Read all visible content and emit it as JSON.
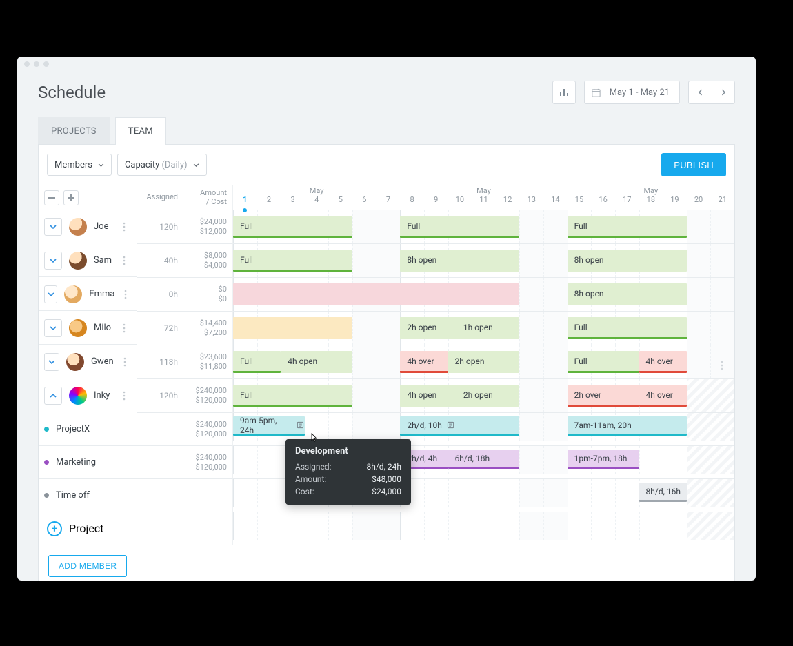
{
  "page_title": "Schedule",
  "range_text": "May 1 - May 21",
  "tabs": {
    "projects": "PROJECTS",
    "team": "TEAM"
  },
  "dropdowns": {
    "members_label": "Members",
    "capacity_label": "Capacity",
    "capacity_mode": "(Daily)"
  },
  "publish_label": "PUBLISH",
  "columns": {
    "assigned": "Assigned",
    "amount_cost": "Amount\n/ Cost"
  },
  "months": [
    "May",
    "May",
    "May"
  ],
  "days": [
    1,
    2,
    3,
    4,
    5,
    6,
    7,
    8,
    9,
    10,
    11,
    12,
    13,
    14,
    15,
    16,
    17,
    18,
    19,
    20,
    21
  ],
  "today_index": 0,
  "members": [
    {
      "name": "Joe",
      "avatar_cls": "av0",
      "assigned": "120h",
      "amount": "$24,000",
      "cost": "$12,000",
      "blocks": [
        {
          "start": 0,
          "span": 5,
          "kind": "full",
          "label": "Full"
        },
        {
          "start": 7,
          "span": 5,
          "kind": "full",
          "label": "Full"
        },
        {
          "start": 14,
          "span": 5,
          "kind": "full",
          "label": "Full"
        }
      ]
    },
    {
      "name": "Sam",
      "avatar_cls": "av1",
      "assigned": "40h",
      "amount": "$8,000",
      "cost": "$4,000",
      "blocks": [
        {
          "start": 0,
          "span": 5,
          "kind": "full",
          "label": "Full"
        },
        {
          "start": 7,
          "span": 5,
          "kind": "open",
          "label": "8h open"
        },
        {
          "start": 14,
          "span": 5,
          "kind": "open",
          "label": "8h open"
        }
      ]
    },
    {
      "name": "Emma",
      "avatar_cls": "av2",
      "assigned": "0h",
      "amount": "$0",
      "cost": "$0",
      "blocks": [
        {
          "start": 0,
          "span": 12,
          "kind": "pink",
          "label": ""
        },
        {
          "start": 14,
          "span": 5,
          "kind": "open",
          "label": "8h open"
        }
      ]
    },
    {
      "name": "Milo",
      "avatar_cls": "av3",
      "assigned": "72h",
      "amount": "$14,400",
      "cost": "$7,200",
      "blocks": [
        {
          "start": 0,
          "span": 5,
          "kind": "yellow",
          "label": ""
        },
        {
          "start": 7,
          "span": 5,
          "kind": "open",
          "labels": [
            "2h open",
            "1h open"
          ]
        },
        {
          "start": 14,
          "span": 5,
          "kind": "full",
          "label": "Full"
        }
      ]
    },
    {
      "name": "Gwen",
      "avatar_cls": "av4",
      "assigned": "118h",
      "amount": "$23,600",
      "cost": "$11,800",
      "blocks": [
        {
          "start": 0,
          "span": 2,
          "kind": "full",
          "label": "Full"
        },
        {
          "start": 2,
          "span": 3,
          "kind": "open",
          "label": "4h open"
        },
        {
          "start": 7,
          "span": 2,
          "kind": "over",
          "label": "4h over"
        },
        {
          "start": 9,
          "span": 3,
          "kind": "open",
          "label": "2h open"
        },
        {
          "start": 14,
          "span": 3,
          "kind": "full",
          "label": "Full"
        },
        {
          "start": 17,
          "span": 2,
          "kind": "over",
          "label": "4h over"
        }
      ]
    },
    {
      "name": "Inky",
      "avatar_cls": "av5",
      "assigned": "120h",
      "amount": "$240,000",
      "cost": "$120,000",
      "expanded": true,
      "blocks": [
        {
          "start": 0,
          "span": 5,
          "kind": "full",
          "label": "Full"
        },
        {
          "start": 7,
          "span": 5,
          "kind": "open",
          "labels": [
            "4h open",
            "2h open"
          ]
        },
        {
          "start": 14,
          "span": 3,
          "kind": "over",
          "label": "2h over"
        },
        {
          "start": 17,
          "span": 2,
          "kind": "over",
          "label": "4h over"
        }
      ]
    }
  ],
  "subrows": [
    {
      "name": "ProjectX",
      "dot": "teal",
      "amount": "$240,000",
      "cost": "$120,000",
      "blocks": [
        {
          "start": 0,
          "span": 3,
          "kind": "teal",
          "label": "9am-5pm, 24h",
          "note": true
        },
        {
          "start": 7,
          "span": 5,
          "kind": "teal",
          "label": "2h/d, 10h",
          "note": true
        },
        {
          "start": 14,
          "span": 5,
          "kind": "teal",
          "label": "7am-11am, 20h"
        }
      ]
    },
    {
      "name": "Marketing",
      "dot": "purple",
      "amount": "$240,000",
      "cost": "$120,000",
      "blocks": [
        {
          "start": 7,
          "span": 2,
          "kind": "purple",
          "label": "2h/d, 4h"
        },
        {
          "start": 9,
          "span": 3,
          "kind": "purple",
          "label": "6h/d, 18h"
        },
        {
          "start": 14,
          "span": 3,
          "kind": "purple",
          "label": "1pm-7pm, 18h"
        }
      ]
    },
    {
      "name": "Time off",
      "dot": "grey",
      "amount": "",
      "cost": "",
      "blocks": [
        {
          "start": 17,
          "span": 2,
          "kind": "grey",
          "label": "8h/d, 16h"
        }
      ]
    }
  ],
  "add_project_label": "Project",
  "add_member_label": "ADD MEMBER",
  "tooltip": {
    "title": "Development",
    "assigned_k": "Assigned:",
    "assigned_v": "8h/d, 24h",
    "amount_k": "Amount:",
    "amount_v": "$48,000",
    "cost_k": "Cost:",
    "cost_v": "$24,000"
  }
}
